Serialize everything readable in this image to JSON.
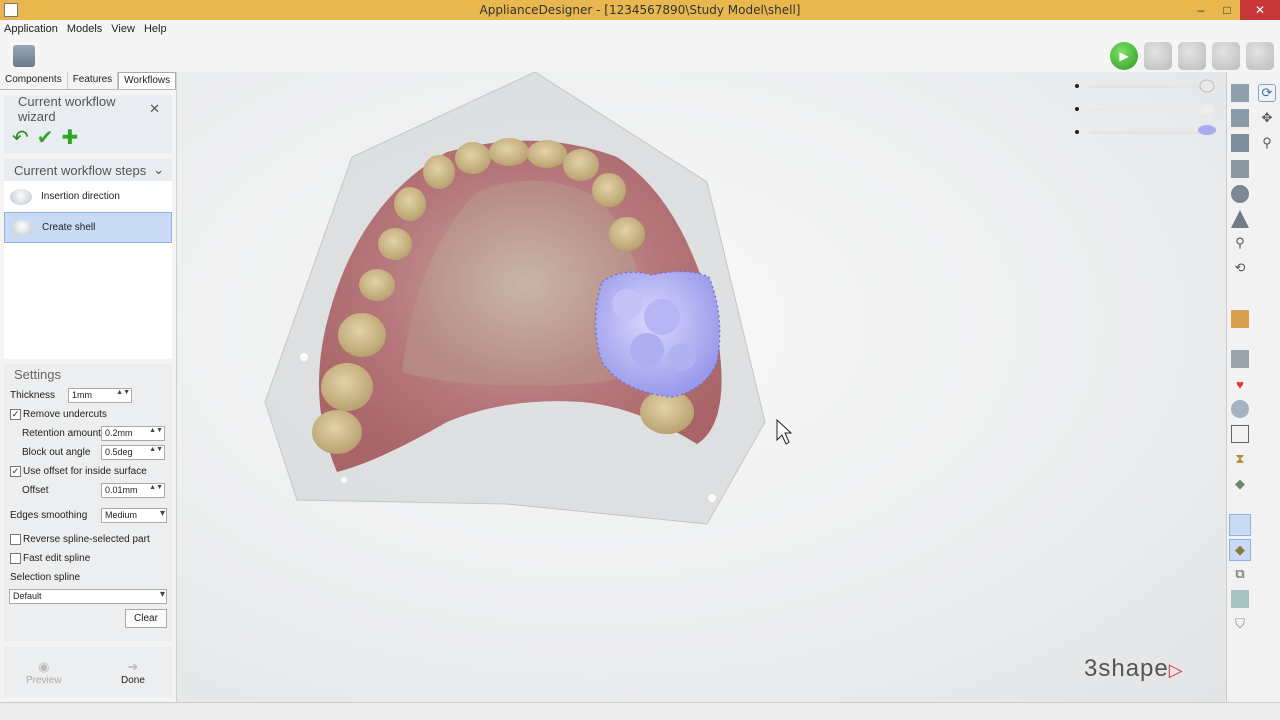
{
  "window": {
    "title": "ApplianceDesigner - [1234567890\\Study Model\\shell]",
    "minimize": "–",
    "maximize": "□",
    "close": "✕"
  },
  "menu": [
    "Application",
    "Models",
    "View",
    "Help"
  ],
  "tabs": [
    "Components",
    "Features",
    "Workflows"
  ],
  "wizard": {
    "title": "Current workflow wizard",
    "close_glyph": "✕",
    "undo_glyph": "↶",
    "check_glyph": "✔",
    "add_glyph": "✚"
  },
  "steps": {
    "title": "Current workflow steps",
    "chevron": "⌄",
    "items": [
      "Insertion direction",
      "Create shell"
    ]
  },
  "settings": {
    "title": "Settings",
    "thickness_label": "Thickness",
    "thickness_value": "1mm",
    "remove_undercuts_label": "Remove undercuts",
    "retention_label": "Retention amount",
    "retention_value": "0.2mm",
    "blockout_label": "Block out angle",
    "blockout_value": "0.5deg",
    "use_offset_label": "Use offset for inside surface",
    "offset_label": "Offset",
    "offset_value": "0.01mm",
    "edges_label": "Edges smoothing",
    "edges_value": "Medium",
    "reverse_label": "Reverse spline-selected part",
    "fast_edit_label": "Fast edit spline",
    "selection_label": "Selection spline",
    "selection_value": "Default",
    "clear_label": "Clear",
    "check_glyph": "✓",
    "spin_glyph": "▲▼",
    "dropdown_glyph": "▾"
  },
  "bottom": {
    "preview_label": "Preview",
    "done_label": "Done",
    "preview_glyph": "◉",
    "done_glyph": "➔"
  },
  "toolbar": {
    "play_glyph": "▶"
  },
  "brand": {
    "logo_text": "3shape",
    "logo_glyph": "▷"
  },
  "colors": {
    "titlebar": "#e8b84f",
    "selection": "#c9daf4",
    "shell_purple": "#a8aaf0"
  }
}
